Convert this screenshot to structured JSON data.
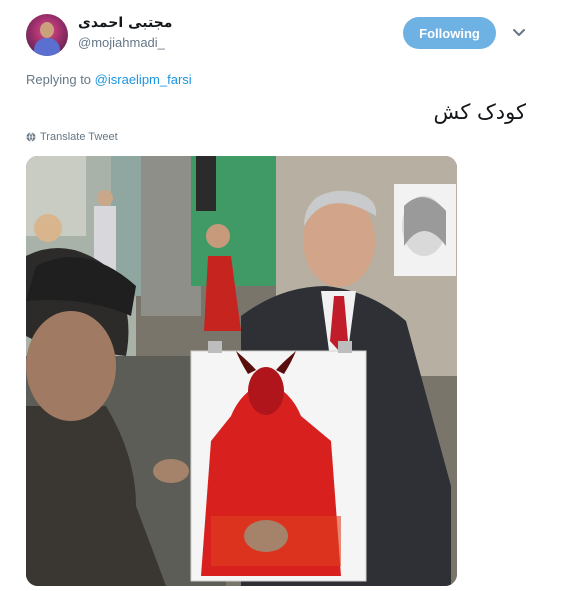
{
  "tweet": {
    "author_name": "مجتبی احمدی",
    "author_handle": "@mojiahmadi_",
    "follow_label": "Following",
    "replying_prefix": "Replying to",
    "replying_mention": "@israelipm_farsi",
    "text": "کودک کش",
    "translate_label": "Translate Tweet"
  },
  "icons": {
    "caret": "chevron-down-icon",
    "globe": "globe-icon"
  },
  "colors": {
    "follow_bg": "#6eb1e3",
    "mention": "#1b95e0",
    "muted": "#657786"
  }
}
